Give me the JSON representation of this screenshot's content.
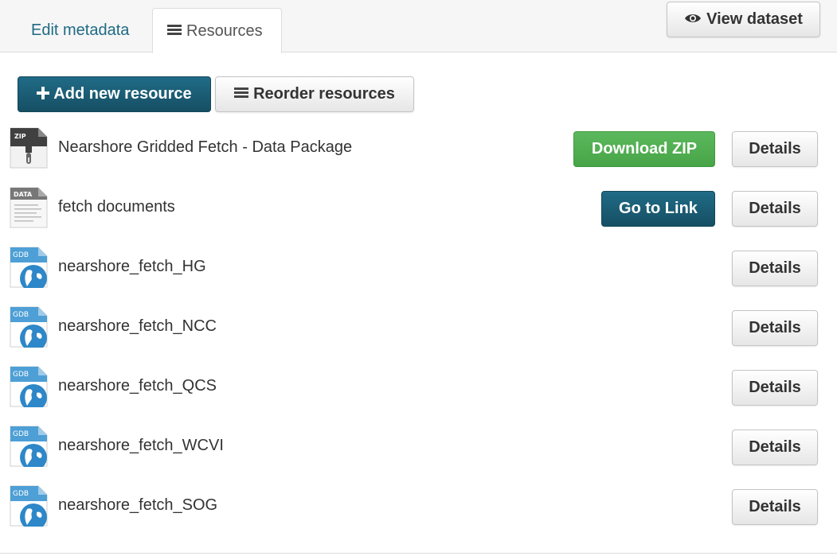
{
  "tabs": {
    "edit_metadata": "Edit metadata",
    "resources": "Resources"
  },
  "header": {
    "view_dataset": "View dataset"
  },
  "actions": {
    "add_new_resource": "Add new resource",
    "reorder_resources": "Reorder resources"
  },
  "colors": {
    "primary": "#1a5e77",
    "success": "#5cb85c",
    "link": "#1e6a83"
  },
  "resources": [
    {
      "name": "Nearshore Gridded Fetch - Data Package",
      "icon": "zip-file-icon",
      "icon_label": "ZIP",
      "action": "Download ZIP",
      "details": "Details"
    },
    {
      "name": "fetch documents",
      "icon": "data-file-icon",
      "icon_label": "DATA",
      "action": "Go to Link",
      "details": "Details"
    },
    {
      "name": "nearshore_fetch_HG",
      "icon": "gdb-file-icon",
      "icon_label": "GDB",
      "details": "Details"
    },
    {
      "name": "nearshore_fetch_NCC",
      "icon": "gdb-file-icon",
      "icon_label": "GDB",
      "details": "Details"
    },
    {
      "name": "nearshore_fetch_QCS",
      "icon": "gdb-file-icon",
      "icon_label": "GDB",
      "details": "Details"
    },
    {
      "name": "nearshore_fetch_WCVI",
      "icon": "gdb-file-icon",
      "icon_label": "GDB",
      "details": "Details"
    },
    {
      "name": "nearshore_fetch_SOG",
      "icon": "gdb-file-icon",
      "icon_label": "GDB",
      "details": "Details"
    }
  ]
}
